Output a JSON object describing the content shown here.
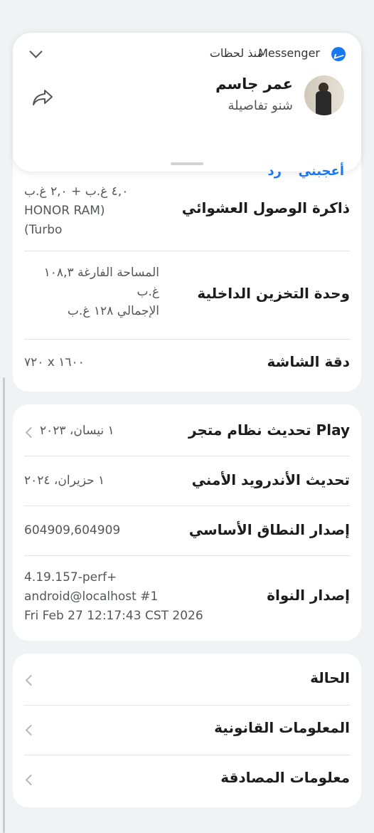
{
  "notification": {
    "app": "Messenger",
    "time": "منذ لحظات",
    "sender": "عمر جاسم",
    "message": "شنو تفاصيلة",
    "like_label": "أعجبني",
    "reply_label": "رد",
    "accent_color": "#1877f2"
  },
  "specs": {
    "ram": {
      "label": "ذاكرة الوصول العشوائي",
      "line1": "٤,٠ غ.ب + ٢,٠ غ.ب",
      "line2": "HONOR RAM)",
      "line3": "(Turbo"
    },
    "storage": {
      "label": "وحدة التخزين الداخلية",
      "line1": "المساحة الفارغة ١٠٨,٣",
      "line2": "غ.ب",
      "line3": "الإجمالي ١٢٨  غ.ب"
    },
    "resolution": {
      "label": "دقة الشاشة",
      "value": "٧٢٠ x ١٦٠٠"
    }
  },
  "software": {
    "play_update": {
      "label": "تحديث نظام متجر Play",
      "value": "١ نيسان، ٢٠٢٣"
    },
    "security_update": {
      "label": "تحديث الأندرويد الأمني",
      "value": "١ حزيران، ٢٠٢٤"
    },
    "baseband": {
      "label": "إصدار النطاق الأساسي",
      "value": "604909,604909"
    },
    "kernel": {
      "label": "إصدار النواة",
      "line1": "4.19.157-perf+",
      "line2": "android@localhost #1",
      "line3": "Fri Feb 27 12:17:43 CST 2026"
    }
  },
  "menu": [
    {
      "label": "الحالة"
    },
    {
      "label": "المعلومات القانونية"
    },
    {
      "label": "معلومات المصادقة"
    }
  ]
}
